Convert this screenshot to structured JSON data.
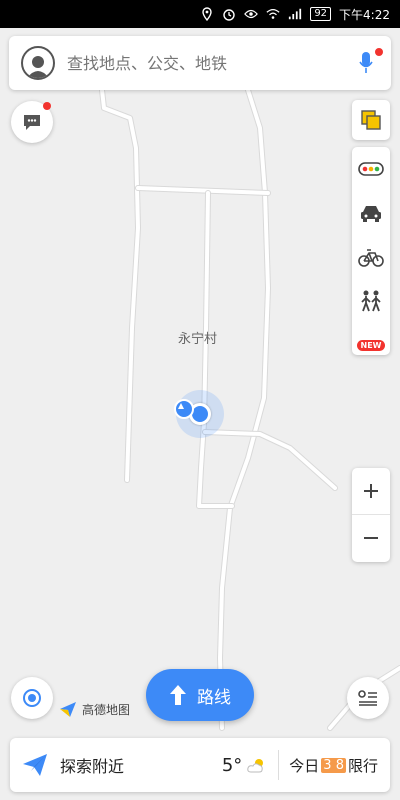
{
  "status_bar": {
    "battery": "92",
    "time": "下午4:22"
  },
  "search": {
    "placeholder": "查找地点、公交、地铁"
  },
  "map": {
    "village_label": "永宁村"
  },
  "right_tools": {
    "new_badge": "NEW"
  },
  "route_button": {
    "label": "路线"
  },
  "logo": {
    "text": "高德地图"
  },
  "bottom_bar": {
    "explore_label": "探索附近",
    "temperature": "5°",
    "limit_prefix": "今日",
    "limit_numbers": "3 8",
    "limit_suffix": "限行"
  },
  "colors": {
    "accent": "#3d8af7",
    "badge_red": "#f2332e",
    "limit_orange": "#f59a4a"
  }
}
